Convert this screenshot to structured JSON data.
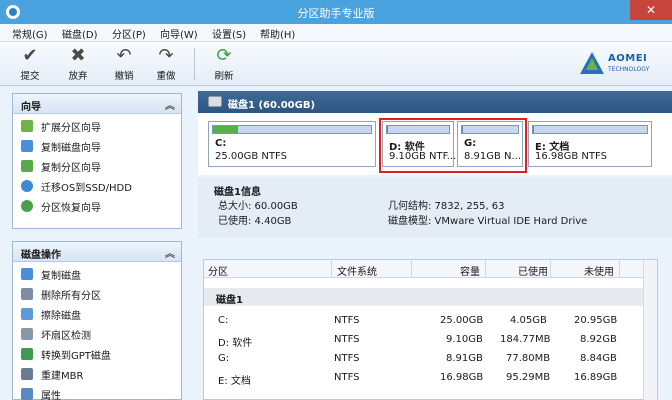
{
  "window": {
    "title": "分区助手专业版",
    "close": "✕"
  },
  "menu": [
    "常规(G)",
    "磁盘(D)",
    "分区(P)",
    "向导(W)",
    "设置(S)",
    "帮助(H)"
  ],
  "toolbar": [
    {
      "icon": "check-icon",
      "glyph": "✔",
      "label": "提交",
      "color": "#4a4a4a"
    },
    {
      "icon": "discard-icon",
      "glyph": "✖",
      "label": "放弃",
      "color": "#4a4a4a"
    },
    {
      "icon": "undo-icon",
      "glyph": "↶",
      "label": "撤销",
      "color": "#4a4a4a"
    },
    {
      "icon": "redo-icon",
      "glyph": "↷",
      "label": "重做",
      "color": "#4a4a4a"
    },
    {
      "icon": "refresh-icon",
      "glyph": "⟳",
      "label": "刷新",
      "color": "#3aa23a"
    }
  ],
  "logo": {
    "line1": "AOMEI",
    "line2": "TECHNOLOGY"
  },
  "wizard_panel": {
    "title": "向导",
    "items": [
      "扩展分区向导",
      "复制磁盘向导",
      "复制分区向导",
      "迁移OS到SSD/HDD",
      "分区恢复向导"
    ]
  },
  "disk_ops_panel": {
    "title": "磁盘操作",
    "items": [
      "复制磁盘",
      "删除所有分区",
      "擦除磁盘",
      "坏扇区检测",
      "转换到GPT磁盘",
      "重建MBR",
      "属性"
    ]
  },
  "disk": {
    "header": "磁盘1 (60.00GB)",
    "partitions": [
      {
        "name": "C:",
        "size": "25.00GB NTFS",
        "used_fraction": 0.16,
        "fill": "#55b04a"
      },
      {
        "name": "D: 软件",
        "size": "9.10GB NTF...",
        "used_fraction": 0.02,
        "fill": "#6a7fb0"
      },
      {
        "name": "G:",
        "size": "8.91GB N...",
        "used_fraction": 0.01,
        "fill": "#6a7fb0"
      },
      {
        "name": "E: 文档",
        "size": "16.98GB NTFS",
        "used_fraction": 0.006,
        "fill": "#6a7fb0"
      }
    ]
  },
  "info": {
    "title": "磁盘1信息",
    "total_label": "总大小: 60.00GB",
    "used_label": "已使用: 4.40GB",
    "geometry_label": "几何结构: 7832, 255, 63",
    "model_label": "磁盘模型: VMware Virtual IDE Hard Drive"
  },
  "table": {
    "columns": [
      "分区",
      "文件系统",
      "容量",
      "已使用",
      "未使用"
    ],
    "group": "磁盘1",
    "rows": [
      [
        "C:",
        "NTFS",
        "25.00GB",
        "4.05GB",
        "20.95GB"
      ],
      [
        "D: 软件",
        "NTFS",
        "9.10GB",
        "184.77MB",
        "8.92GB"
      ],
      [
        "G:",
        "NTFS",
        "8.91GB",
        "77.80MB",
        "8.84GB"
      ],
      [
        "E: 文档",
        "NTFS",
        "16.98GB",
        "95.29MB",
        "16.89GB"
      ]
    ]
  }
}
